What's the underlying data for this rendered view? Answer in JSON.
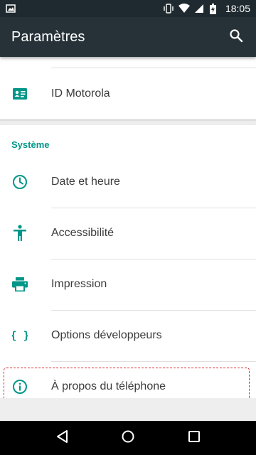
{
  "status_bar": {
    "time": "18:05",
    "icons": [
      "image-notification-icon",
      "vibrate-icon",
      "wifi-icon",
      "signal-icon",
      "battery-charging-icon"
    ]
  },
  "app_bar": {
    "title": "Paramètres",
    "search_icon": "search-icon"
  },
  "top_card": {
    "items": [
      {
        "label": "ID Motorola",
        "icon": "id-card-icon"
      }
    ]
  },
  "system_section": {
    "header": "Système",
    "items": [
      {
        "label": "Date et heure",
        "icon": "clock-icon"
      },
      {
        "label": "Accessibilité",
        "icon": "accessibility-icon"
      },
      {
        "label": "Impression",
        "icon": "printer-icon"
      },
      {
        "label": "Options développeurs",
        "icon": "braces-icon"
      },
      {
        "label": "À propos du téléphone",
        "icon": "info-icon"
      }
    ]
  },
  "nav_bar": {
    "icons": [
      "back-icon",
      "home-icon",
      "recents-icon"
    ]
  },
  "colors": {
    "accent": "#009688",
    "app_bar": "#263238",
    "status_bar": "#1f2a30",
    "highlight": "#d32f2f"
  }
}
